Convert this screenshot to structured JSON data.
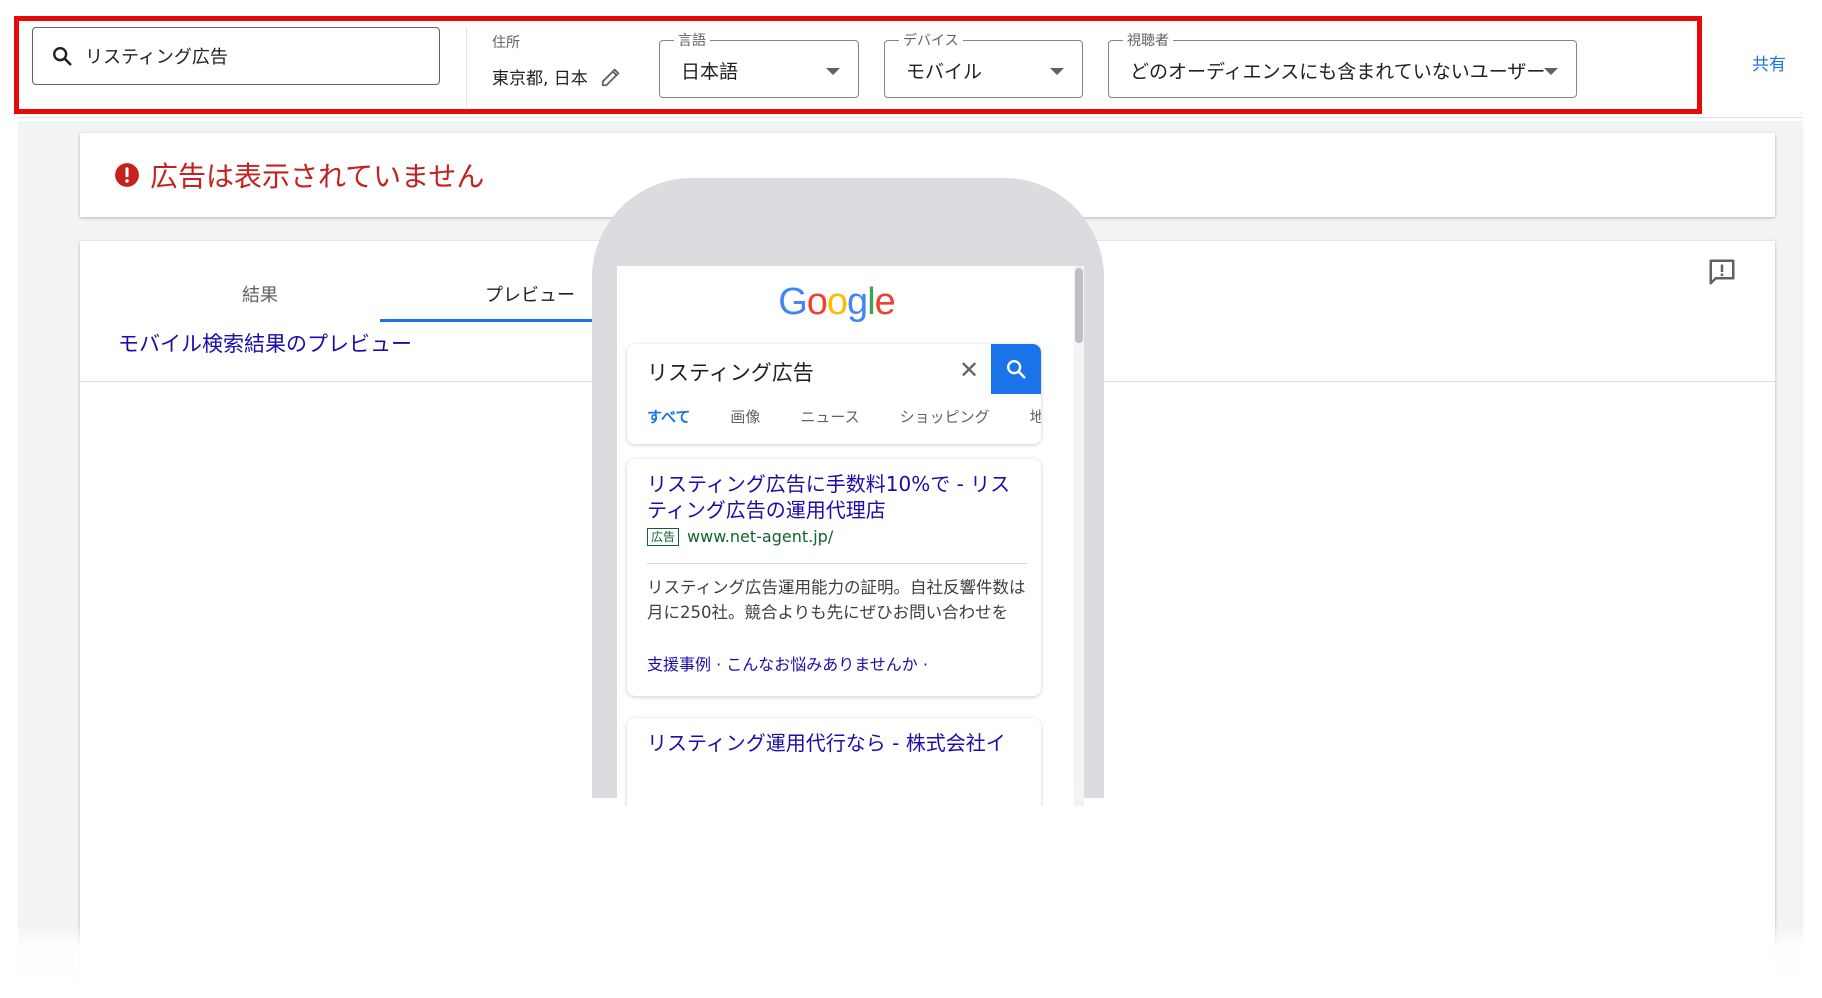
{
  "toolbar": {
    "search_query": "リスティング広告",
    "location_label": "住所",
    "location_value": "東京都, 日本",
    "language": {
      "label": "言語",
      "value": "日本語"
    },
    "device": {
      "label": "デバイス",
      "value": "モバイル"
    },
    "audience": {
      "label": "視聴者",
      "value": "どのオーディエンスにも含まれていないユーザー"
    },
    "share_label": "共有"
  },
  "alert": {
    "message": "広告は表示されていません",
    "color": "#c5221f"
  },
  "tabs": [
    {
      "label": "結果",
      "active": false
    },
    {
      "label": "プレビュー",
      "active": true
    }
  ],
  "preview_link": "モバイル検索結果のプレビュー",
  "mobile_preview": {
    "search_query": "リスティング広告",
    "search_tabs": [
      "すべて",
      "画像",
      "ニュース",
      "ショッピング",
      "地"
    ],
    "ads": [
      {
        "title": "リスティング広告に手数料10%で - リスティング広告の運用代理店",
        "badge": "広告",
        "url": "www.net-agent.jp/",
        "description": "リスティング広告運用能力の証明。自社反響件数は月に250社。競合よりも先にぜひお問い合わせを",
        "sitelinks": "支援事例 · こんなお悩みありませんか ·"
      },
      {
        "title": "リスティング運用代行なら - 株式会社イ"
      }
    ]
  },
  "colors": {
    "accent": "#1a73e8",
    "highlight_frame": "#e8090b",
    "ad_url": "#0d652d",
    "link": "#1a0dab"
  }
}
